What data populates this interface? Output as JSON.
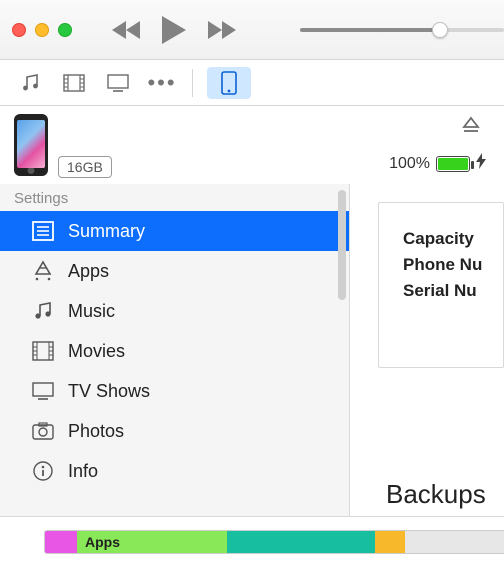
{
  "mediabar": {
    "more_glyph": "•••"
  },
  "device": {
    "capacity_badge": "16GB",
    "battery_percent": "100%"
  },
  "sidebar": {
    "section": "Settings",
    "items": [
      {
        "label": "Summary"
      },
      {
        "label": "Apps"
      },
      {
        "label": "Music"
      },
      {
        "label": "Movies"
      },
      {
        "label": "TV Shows"
      },
      {
        "label": "Photos"
      },
      {
        "label": "Info"
      }
    ]
  },
  "content": {
    "capacity_label": "Capacity",
    "phone_label": "Phone Nu",
    "serial_label": "Serial Nu",
    "backups_heading": "Backups"
  },
  "storage": {
    "apps_label": "Apps"
  }
}
